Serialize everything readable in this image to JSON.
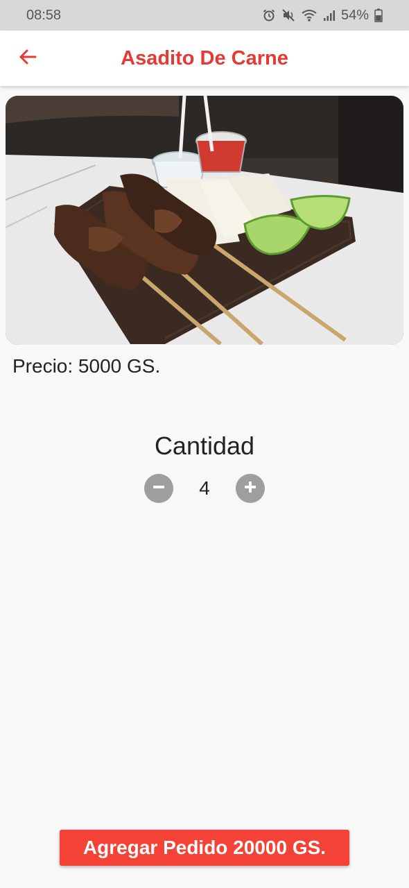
{
  "status_bar": {
    "time": "08:58",
    "battery_text": "54%",
    "icons": [
      "alarm-icon",
      "mute-icon",
      "wifi-icon",
      "signal-icon",
      "battery-icon"
    ]
  },
  "app_bar": {
    "title": "Asadito De Carne",
    "back_icon": "arrow-left-icon",
    "accent_color": "#e53935"
  },
  "product": {
    "image_alt": "photo",
    "price_text": "Precio: 5000 GS."
  },
  "quantity": {
    "label": "Cantidad",
    "value": "4",
    "decrement_icon": "minus-icon",
    "increment_icon": "plus-icon"
  },
  "cta": {
    "label": "Agregar Pedido 20000 GS.",
    "color": "#f44336"
  }
}
